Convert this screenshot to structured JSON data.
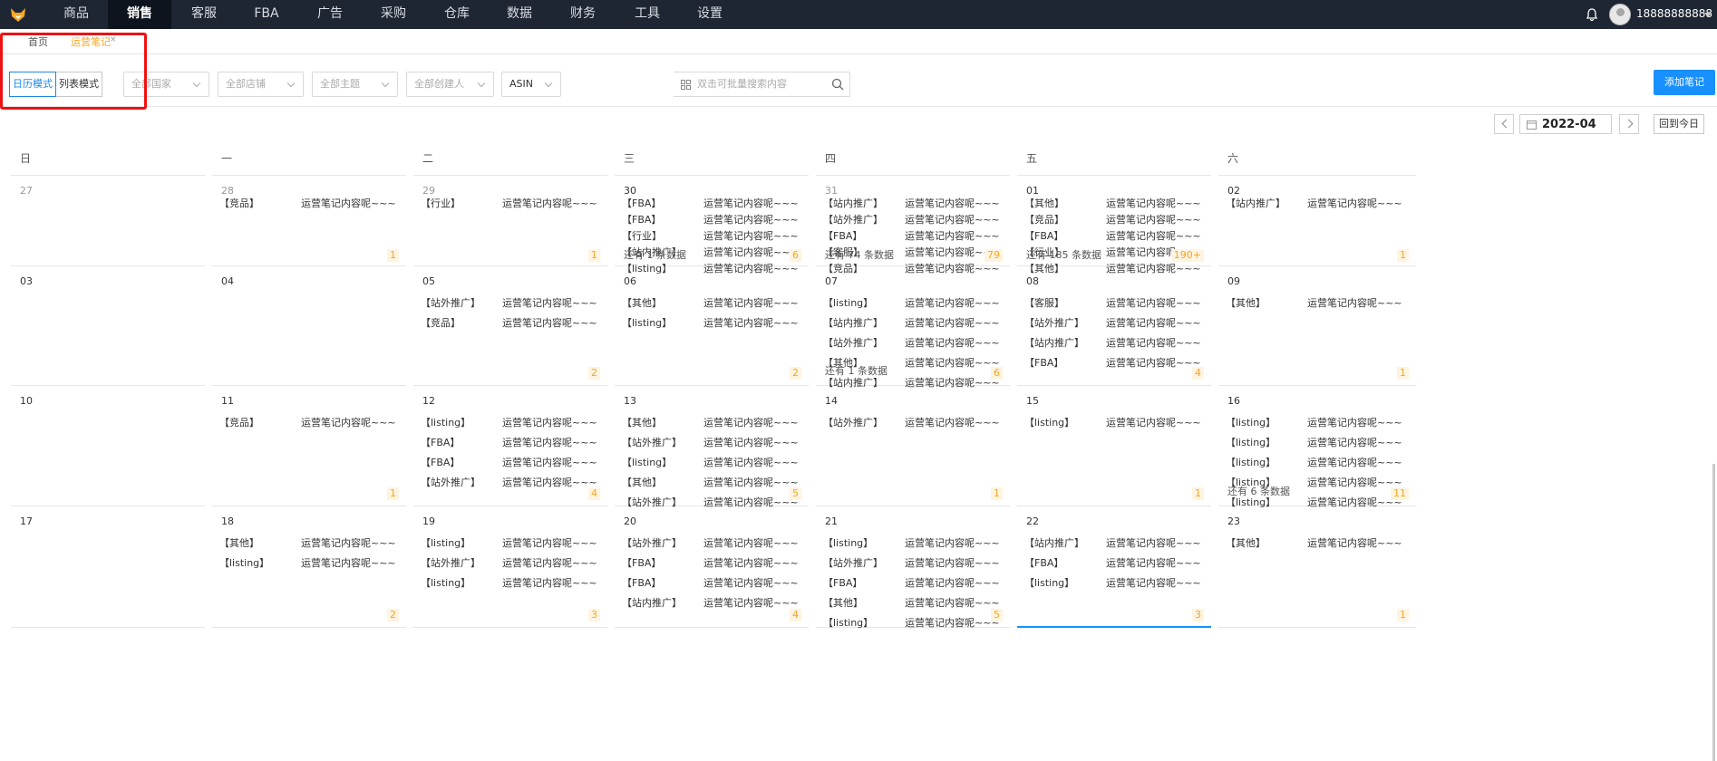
{
  "topnav": {
    "items": [
      {
        "label": "商品",
        "active": false
      },
      {
        "label": "销售",
        "active": true
      },
      {
        "label": "客服",
        "active": false
      },
      {
        "label": "FBA",
        "active": false
      },
      {
        "label": "广告",
        "active": false
      },
      {
        "label": "采购",
        "active": false
      },
      {
        "label": "仓库",
        "active": false
      },
      {
        "label": "数据",
        "active": false
      },
      {
        "label": "财务",
        "active": false
      },
      {
        "label": "工具",
        "active": false
      },
      {
        "label": "设置",
        "active": false
      }
    ],
    "username": "18888888888"
  },
  "tabs": [
    {
      "label": "首页",
      "active": false
    },
    {
      "label": "运营笔记",
      "active": true,
      "close": "×"
    }
  ],
  "filters": {
    "mode_calendar": "日历模式",
    "mode_list": "列表模式",
    "country": "全部国家",
    "shop": "全部店铺",
    "topic": "全部主题",
    "creator": "全部创建人",
    "asin": "ASIN",
    "search_placeholder": "双击可批量搜索内容",
    "add_note": "添加笔记"
  },
  "month_nav": {
    "month": "2022-04",
    "today": "回到今日"
  },
  "calendar": {
    "weekdays": [
      "日",
      "一",
      "二",
      "三",
      "四",
      "五",
      "六"
    ],
    "weeks": [
      [
        {
          "day": "27",
          "other": true,
          "entries": [],
          "more": "",
          "count": ""
        },
        {
          "day": "28",
          "other": true,
          "entries": [
            {
              "cat": "【竞品】",
              "text": "运营笔记内容呢~~~"
            }
          ],
          "more": "",
          "count": "1"
        },
        {
          "day": "29",
          "other": true,
          "entries": [
            {
              "cat": "【行业】",
              "text": "运营笔记内容呢~~~"
            }
          ],
          "more": "",
          "count": "1"
        },
        {
          "day": "30",
          "other": false,
          "entries": [
            {
              "cat": "【FBA】",
              "text": "运营笔记内容呢~~~"
            },
            {
              "cat": "【FBA】",
              "text": "运营笔记内容呢~~~"
            },
            {
              "cat": "【行业】",
              "text": "运营笔记内容呢~~~"
            },
            {
              "cat": "【站内推广】",
              "text": "运营笔记内容呢~~~"
            },
            {
              "cat": "【listing】",
              "text": "运营笔记内容呢~~~"
            }
          ],
          "more": "还有 1 条数据",
          "count": "6"
        },
        {
          "day": "31",
          "other": true,
          "entries": [
            {
              "cat": "【站内推广】",
              "text": "运营笔记内容呢~~~"
            },
            {
              "cat": "【站外推广】",
              "text": "运营笔记内容呢~~~"
            },
            {
              "cat": "【FBA】",
              "text": "运营笔记内容呢~~~"
            },
            {
              "cat": "【客服】",
              "text": "运营笔记内容呢~~~"
            },
            {
              "cat": "【竞品】",
              "text": "运营笔记内容呢~~~"
            }
          ],
          "more": "还有 74 条数据",
          "count": "79"
        },
        {
          "day": "01",
          "other": false,
          "entries": [
            {
              "cat": "【其他】",
              "text": "运营笔记内容呢~~~"
            },
            {
              "cat": "【竞品】",
              "text": "运营笔记内容呢~~~"
            },
            {
              "cat": "【FBA】",
              "text": "运营笔记内容呢~~~"
            },
            {
              "cat": "【行业】",
              "text": "运营笔记内容呢~~~"
            },
            {
              "cat": "【其他】",
              "text": "运营笔记内容呢~~~"
            }
          ],
          "more": "还有 185 条数据",
          "count": "190+"
        },
        {
          "day": "02",
          "other": false,
          "entries": [
            {
              "cat": "【站内推广】",
              "text": "运营笔记内容呢~~~"
            }
          ],
          "more": "",
          "count": "1"
        }
      ],
      [
        {
          "day": "03",
          "other": false,
          "entries": [],
          "more": "",
          "count": ""
        },
        {
          "day": "04",
          "other": false,
          "entries": [],
          "more": "",
          "count": ""
        },
        {
          "day": "05",
          "other": false,
          "entries": [
            {
              "cat": "【站外推广】",
              "text": "运营笔记内容呢~~~"
            },
            {
              "cat": "【竞品】",
              "text": "运营笔记内容呢~~~"
            }
          ],
          "more": "",
          "count": "2"
        },
        {
          "day": "06",
          "other": false,
          "entries": [
            {
              "cat": "【其他】",
              "text": "运营笔记内容呢~~~"
            },
            {
              "cat": "【listing】",
              "text": "运营笔记内容呢~~~"
            }
          ],
          "more": "",
          "count": "2"
        },
        {
          "day": "07",
          "other": false,
          "entries": [
            {
              "cat": "【listing】",
              "text": "运营笔记内容呢~~~"
            },
            {
              "cat": "【站内推广】",
              "text": "运营笔记内容呢~~~"
            },
            {
              "cat": "【站外推广】",
              "text": "运营笔记内容呢~~~"
            },
            {
              "cat": "【其他】",
              "text": "运营笔记内容呢~~~"
            },
            {
              "cat": "【站内推广】",
              "text": "运营笔记内容呢~~~"
            }
          ],
          "more": "还有 1 条数据",
          "count": "6"
        },
        {
          "day": "08",
          "other": false,
          "entries": [
            {
              "cat": "【客服】",
              "text": "运营笔记内容呢~~~"
            },
            {
              "cat": "【站外推广】",
              "text": "运营笔记内容呢~~~"
            },
            {
              "cat": "【站内推广】",
              "text": "运营笔记内容呢~~~"
            },
            {
              "cat": "【FBA】",
              "text": "运营笔记内容呢~~~"
            }
          ],
          "more": "",
          "count": "4"
        },
        {
          "day": "09",
          "other": false,
          "entries": [
            {
              "cat": "【其他】",
              "text": "运营笔记内容呢~~~"
            }
          ],
          "more": "",
          "count": "1"
        }
      ],
      [
        {
          "day": "10",
          "other": false,
          "entries": [],
          "more": "",
          "count": ""
        },
        {
          "day": "11",
          "other": false,
          "entries": [
            {
              "cat": "【竞品】",
              "text": "运营笔记内容呢~~~"
            }
          ],
          "more": "",
          "count": "1"
        },
        {
          "day": "12",
          "other": false,
          "entries": [
            {
              "cat": "【listing】",
              "text": "运营笔记内容呢~~~"
            },
            {
              "cat": "【FBA】",
              "text": "运营笔记内容呢~~~"
            },
            {
              "cat": "【FBA】",
              "text": "运营笔记内容呢~~~"
            },
            {
              "cat": "【站外推广】",
              "text": "运营笔记内容呢~~~"
            }
          ],
          "more": "",
          "count": "4"
        },
        {
          "day": "13",
          "other": false,
          "entries": [
            {
              "cat": "【其他】",
              "text": "运营笔记内容呢~~~"
            },
            {
              "cat": "【站外推广】",
              "text": "运营笔记内容呢~~~"
            },
            {
              "cat": "【listing】",
              "text": "运营笔记内容呢~~~"
            },
            {
              "cat": "【其他】",
              "text": "运营笔记内容呢~~~"
            },
            {
              "cat": "【站外推广】",
              "text": "运营笔记内容呢~~~"
            }
          ],
          "more": "",
          "count": "5"
        },
        {
          "day": "14",
          "other": false,
          "entries": [
            {
              "cat": "【站外推广】",
              "text": "运营笔记内容呢~~~"
            }
          ],
          "more": "",
          "count": "1"
        },
        {
          "day": "15",
          "other": false,
          "entries": [
            {
              "cat": "【listing】",
              "text": "运营笔记内容呢~~~"
            }
          ],
          "more": "",
          "count": "1"
        },
        {
          "day": "16",
          "other": false,
          "entries": [
            {
              "cat": "【listing】",
              "text": "运营笔记内容呢~~~"
            },
            {
              "cat": "【listing】",
              "text": "运营笔记内容呢~~~"
            },
            {
              "cat": "【listing】",
              "text": "运营笔记内容呢~~~"
            },
            {
              "cat": "【listing】",
              "text": "运营笔记内容呢~~~"
            },
            {
              "cat": "【listing】",
              "text": "运营笔记内容呢~~~"
            }
          ],
          "more": "还有 6 条数据",
          "count": "11"
        }
      ],
      [
        {
          "day": "17",
          "other": false,
          "entries": [],
          "more": "",
          "count": ""
        },
        {
          "day": "18",
          "other": false,
          "entries": [
            {
              "cat": "【其他】",
              "text": "运营笔记内容呢~~~"
            },
            {
              "cat": "【listing】",
              "text": "运营笔记内容呢~~~"
            }
          ],
          "more": "",
          "count": "2"
        },
        {
          "day": "19",
          "other": false,
          "entries": [
            {
              "cat": "【listing】",
              "text": "运营笔记内容呢~~~"
            },
            {
              "cat": "【站外推广】",
              "text": "运营笔记内容呢~~~"
            },
            {
              "cat": "【listing】",
              "text": "运营笔记内容呢~~~"
            }
          ],
          "more": "",
          "count": "3"
        },
        {
          "day": "20",
          "other": false,
          "entries": [
            {
              "cat": "【站外推广】",
              "text": "运营笔记内容呢~~~"
            },
            {
              "cat": "【FBA】",
              "text": "运营笔记内容呢~~~"
            },
            {
              "cat": "【FBA】",
              "text": "运营笔记内容呢~~~"
            },
            {
              "cat": "【站内推广】",
              "text": "运营笔记内容呢~~~"
            }
          ],
          "more": "",
          "count": "4"
        },
        {
          "day": "21",
          "other": false,
          "entries": [
            {
              "cat": "【listing】",
              "text": "运营笔记内容呢~~~"
            },
            {
              "cat": "【站外推广】",
              "text": "运营笔记内容呢~~~"
            },
            {
              "cat": "【FBA】",
              "text": "运营笔记内容呢~~~"
            },
            {
              "cat": "【其他】",
              "text": "运营笔记内容呢~~~"
            },
            {
              "cat": "【listing】",
              "text": "运营笔记内容呢~~~"
            }
          ],
          "more": "",
          "count": "5"
        },
        {
          "day": "22",
          "other": false,
          "today": true,
          "entries": [
            {
              "cat": "【站内推广】",
              "text": "运营笔记内容呢~~~"
            },
            {
              "cat": "【FBA】",
              "text": "运营笔记内容呢~~~"
            },
            {
              "cat": "【listing】",
              "text": "运营笔记内容呢~~~"
            }
          ],
          "more": "",
          "count": "3"
        },
        {
          "day": "23",
          "other": false,
          "entries": [
            {
              "cat": "【其他】",
              "text": "运营笔记内容呢~~~"
            }
          ],
          "more": "",
          "count": "1"
        }
      ]
    ]
  }
}
